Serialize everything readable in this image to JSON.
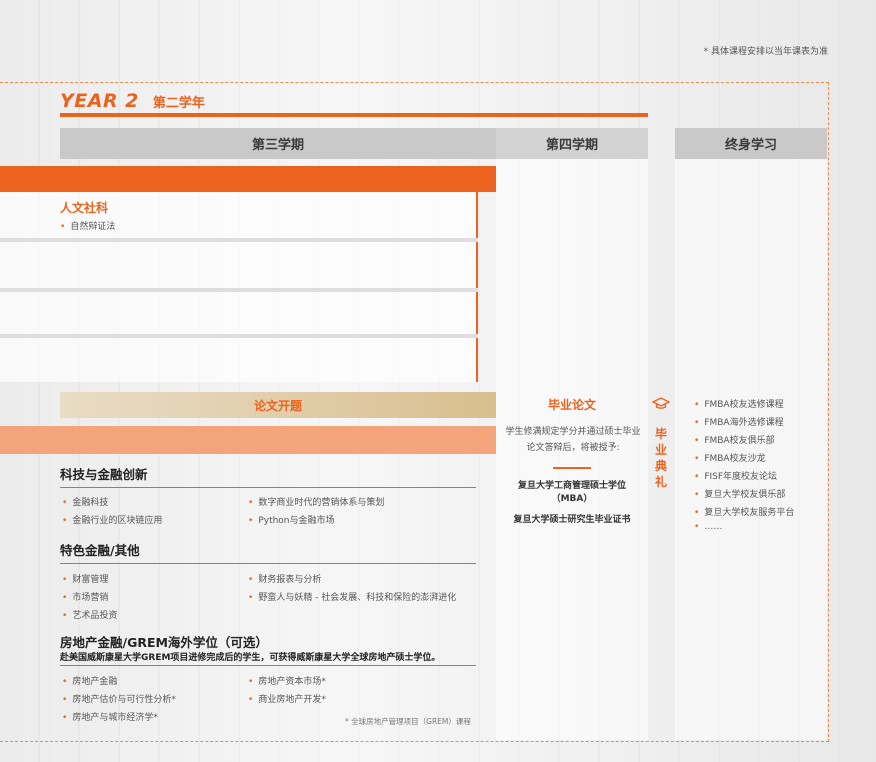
{
  "note_top": "* 具体课程安排以当年课表为准",
  "year": {
    "en": "YEAR 2",
    "zh": "第二学年"
  },
  "headers": {
    "term3": "第三学期",
    "term4": "第四学期",
    "lifelong": "终身学习"
  },
  "humanities": {
    "title": "人文社科",
    "items": [
      "自然辩证法"
    ]
  },
  "thesis_open": "论文开题",
  "fintech": {
    "title": "科技与金融创新",
    "left": [
      "金融科技",
      "金融行业的区块链应用"
    ],
    "right": [
      "数字商业时代的营销体系与策划",
      "Python与金融市场"
    ]
  },
  "special": {
    "title": "特色金融/其他",
    "left": [
      "财富管理",
      "市场营销",
      "艺术品投资"
    ],
    "right": [
      "财务报表与分析",
      "野蛮人与妖精 - 社会发展、科技和保险的澎湃进化"
    ]
  },
  "realestate": {
    "title": "房地产金融/GREM海外学位（可选）",
    "subtitle": "赴美国威斯康星大学GREM项目进修完成后的学生，可获得威斯康星大学全球房地产硕士学位。",
    "left": [
      "房地产金融",
      "房地产估价与可行性分析*",
      "房地产与城市经济学*"
    ],
    "right": [
      "房地产资本市场*",
      "商业房地产开发*"
    ],
    "footnote": "* 全球房地产管理项目（GREM）课程"
  },
  "thesis": {
    "title": "毕业论文",
    "desc": "学生修满规定学分并通过硕士毕业论文答辩后，将被授予:",
    "degree1": "复旦大学工商管理硕士学位（MBA）",
    "degree2": "复旦大学硕士研究生毕业证书"
  },
  "graduation": {
    "chars": [
      "毕",
      "业",
      "典",
      "礼"
    ],
    "icon": "graduation-cap-icon"
  },
  "lifelong": {
    "items": [
      "FMBA校友选修课程",
      "FMBA海外选修课程",
      "FMBA校友俱乐部",
      "FMBA校友沙龙",
      "FISF年度校友论坛",
      "复旦大学校友俱乐部",
      "复旦大学校友服务平台",
      "……"
    ]
  },
  "colors": {
    "accent": "#ec6320",
    "header_gray": "#c9c9c9",
    "salmon": "#f4a47a",
    "gold": "#d8bf8f"
  }
}
